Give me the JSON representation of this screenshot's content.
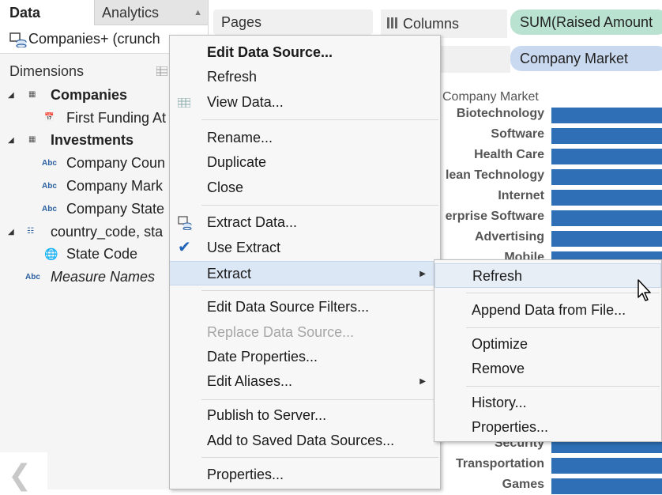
{
  "tabs": {
    "data": "Data",
    "analytics": "Analytics"
  },
  "data_source": {
    "name": "Companies+ (crunch"
  },
  "dimensions": {
    "header": "Dimensions",
    "tree": [
      {
        "label": "Companies",
        "kind": "table",
        "expanded": true
      },
      {
        "label": "First Funding At",
        "kind": "date"
      },
      {
        "label": "Investments",
        "kind": "table",
        "expanded": true
      },
      {
        "label": "Company Coun",
        "kind": "string",
        "icon": "Abc"
      },
      {
        "label": "Company Mark",
        "kind": "string",
        "icon": "Abc"
      },
      {
        "label": "Company State",
        "kind": "string",
        "icon": "Abc"
      },
      {
        "label": "country_code, sta",
        "kind": "hierarchy",
        "expanded": true
      },
      {
        "label": "State Code",
        "kind": "geo"
      },
      {
        "label": "Measure Names",
        "kind": "string",
        "icon": "Abc"
      }
    ]
  },
  "shelves": {
    "pages": "Pages",
    "columns": "Columns",
    "columns_pill": "SUM(Raised Amount",
    "rows_pill": "Company Market"
  },
  "context_menu": {
    "items": [
      {
        "label": "Edit Data Source...",
        "bold": true
      },
      {
        "label": "Refresh"
      },
      {
        "label": "View Data...",
        "icon": "grid-icon"
      },
      {
        "label": "Rename..."
      },
      {
        "label": "Duplicate"
      },
      {
        "label": "Close"
      },
      {
        "label": "Extract Data...",
        "icon": "extract-icon"
      },
      {
        "label": "Use Extract",
        "checked": true
      },
      {
        "label": "Extract",
        "submenu": true,
        "highlighted": true
      },
      {
        "label": "Edit Data Source Filters..."
      },
      {
        "label": "Replace Data Source...",
        "disabled": true
      },
      {
        "label": "Date Properties..."
      },
      {
        "label": "Edit Aliases...",
        "submenu": true
      },
      {
        "label": "Publish to Server..."
      },
      {
        "label": "Add to Saved Data Sources..."
      },
      {
        "label": "Properties..."
      }
    ]
  },
  "extract_submenu": {
    "items": [
      {
        "label": "Refresh",
        "highlighted": true
      },
      {
        "label": "Append Data from File..."
      },
      {
        "label": "Optimize"
      },
      {
        "label": "Remove"
      },
      {
        "label": "History..."
      },
      {
        "label": "Properties..."
      }
    ]
  },
  "chart": {
    "axis_header": "Company Market",
    "categories": [
      "Biotechnology",
      "Software",
      "Health Care",
      "lean Technology",
      "Internet",
      "erprise Software",
      "Advertising",
      "Mobile",
      "Security",
      "Transportation",
      "Games"
    ],
    "bar_color": "#2e6fb5"
  },
  "colors": {
    "accent": "#2e6fb5",
    "columns_pill": "#b9e2d0",
    "rows_pill": "#c9d9ef",
    "menu_highlight": "#dbe7f5"
  }
}
